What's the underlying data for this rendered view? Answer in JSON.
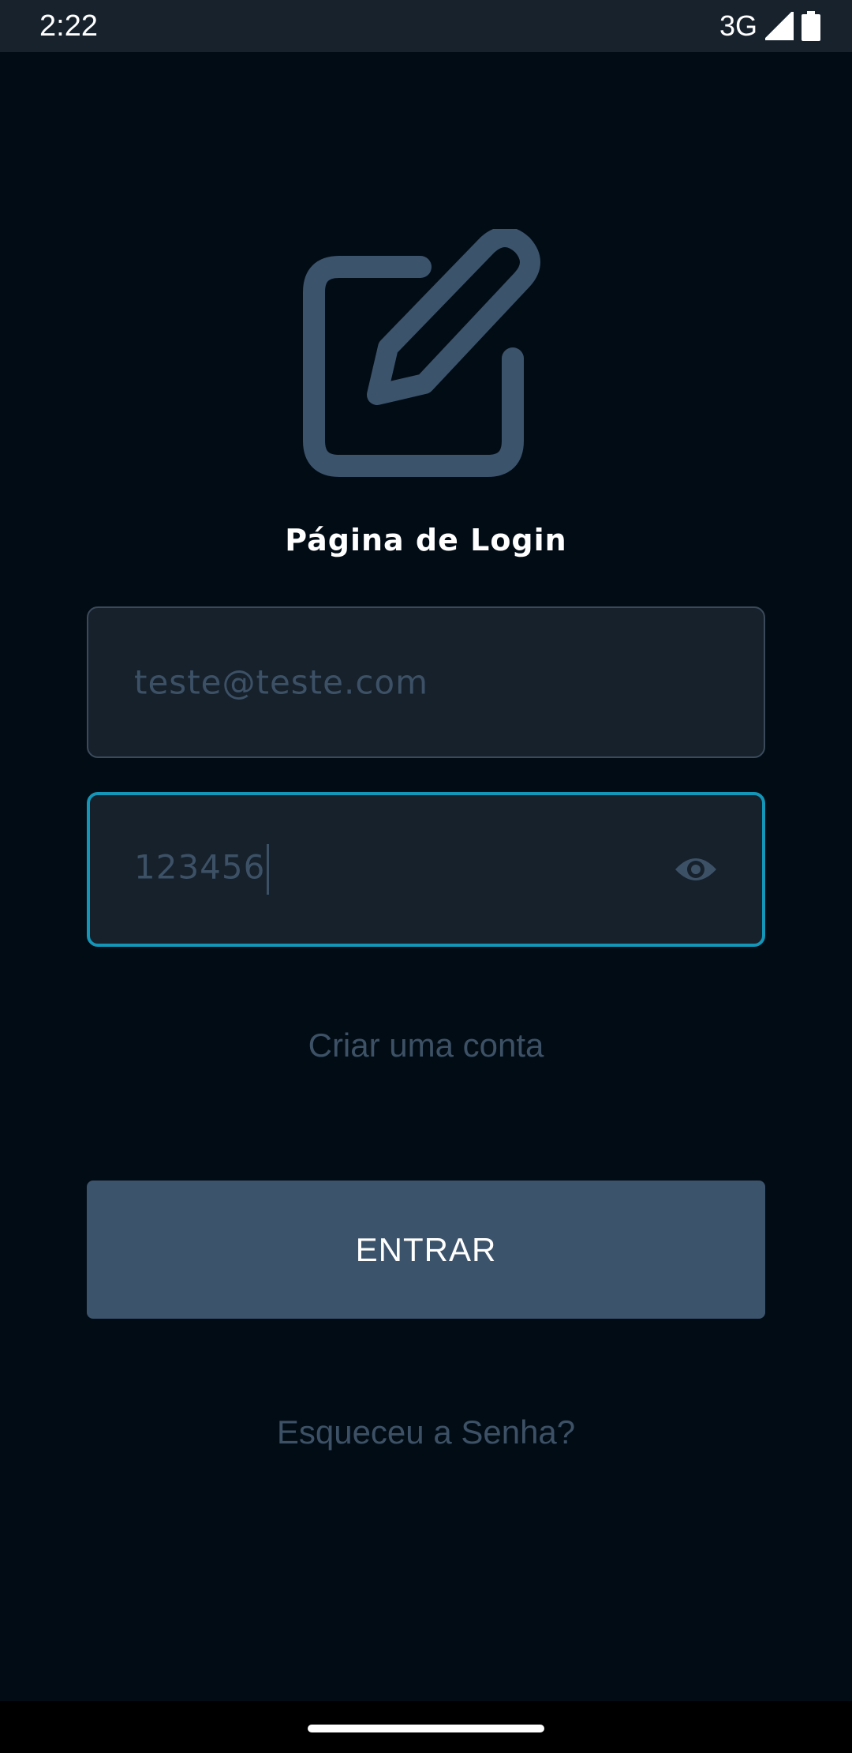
{
  "status_bar": {
    "time": "2:22",
    "network": "3G",
    "signal_icon": "cell-signal-icon",
    "battery_icon": "battery-icon"
  },
  "logo": {
    "icon": "edit-square-icon",
    "color": "#3c536c"
  },
  "page": {
    "title": "Página de Login"
  },
  "form": {
    "email_value": "teste@teste.com",
    "password_value": "123456",
    "password_toggle_icon": "eye-icon",
    "create_account_label": "Criar uma conta",
    "submit_label": "ENTRAR",
    "forgot_password_label": "Esqueceu a Senha?"
  },
  "colors": {
    "background": "#020c15",
    "field_background": "#16212c",
    "focus_border": "#1496b8",
    "button": "#3c536c",
    "muted_text": "#3d5166"
  }
}
